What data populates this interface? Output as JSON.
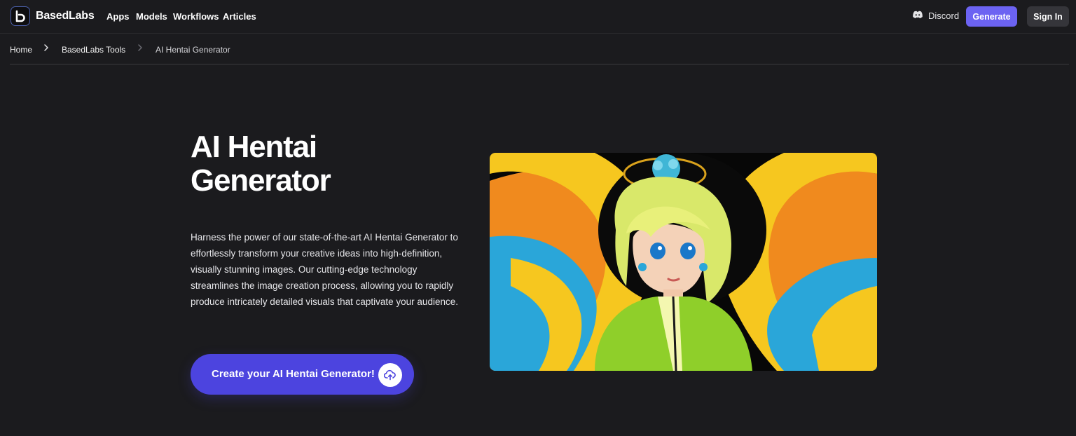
{
  "header": {
    "brand": "BasedLabs",
    "nav": [
      "Apps",
      "Models",
      "Workflows",
      "Articles"
    ],
    "discord_label": "Discord",
    "generate_label": "Generate",
    "signin_label": "Sign In"
  },
  "breadcrumb": [
    "Home",
    "BasedLabs Tools",
    "AI Hentai Generator"
  ],
  "hero": {
    "title_line1": "AI Hentai",
    "title_line2": "Generator",
    "description": "Harness the power of our state-of-the-art AI Hentai Generator to effortlessly transform your creative ideas into high-definition, visually stunning images. Our cutting-edge technology streamlines the image creation process, allowing you to rapidly produce intricately detailed visuals that captivate your audience.",
    "cta_label": "Create your AI Hentai Generator!"
  },
  "icons": {
    "logo": "basedlabs-logo-icon",
    "discord": "discord-icon",
    "breadcrumb_separator": "chevron-right-icon",
    "cta": "cloud-upload-icon"
  },
  "colors": {
    "background": "#1b1b1e",
    "accent": "#6c63f2",
    "cta": "#4c44df",
    "signin_bg": "#35353a"
  }
}
